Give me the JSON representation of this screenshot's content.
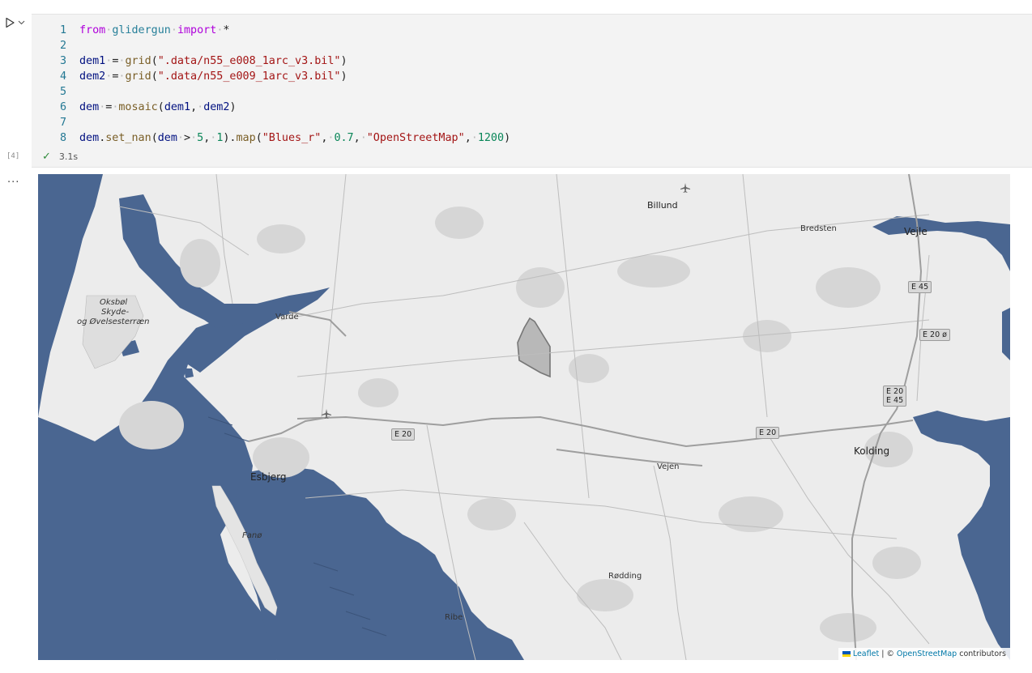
{
  "cell": {
    "execution_count": "[4]",
    "duration": "3.1s",
    "output_more": "..."
  },
  "code": {
    "lines": [
      {
        "n": "1",
        "text": "from glidergun import *"
      },
      {
        "n": "2",
        "text": ""
      },
      {
        "n": "3",
        "text": "dem1 = grid(\".data/n55_e008_1arc_v3.bil\")"
      },
      {
        "n": "4",
        "text": "dem2 = grid(\".data/n55_e009_1arc_v3.bil\")"
      },
      {
        "n": "5",
        "text": ""
      },
      {
        "n": "6",
        "text": "dem = mosaic(dem1, dem2)"
      },
      {
        "n": "7",
        "text": ""
      },
      {
        "n": "8",
        "text": "dem.set_nan(dem > 5, 1).map(\"Blues_r\", 0.7, \"OpenStreetMap\", 1200)"
      }
    ]
  },
  "map": {
    "water_color": "#4a6691",
    "land_color": "#ececec",
    "places": {
      "billund": "Billund",
      "bredsten": "Bredsten",
      "vejle": "Vejle",
      "oksbol_1": "Oksbøl",
      "oksbol_2": "Skyde-",
      "oksbol_3": "og Øvelsesterræn",
      "varde": "Varde",
      "esbjerg": "Esbjerg",
      "fano": "Fanø",
      "vejen": "Vejen",
      "kolding": "Kolding",
      "rodding": "Rødding",
      "ribe": "Ribe"
    },
    "shields": {
      "e20_west": "E 20",
      "e20_mid": "E 20",
      "e45": "E 45",
      "e20o": "E 20 ø",
      "e20_e45_a": "E 20",
      "e20_e45_b": "E 45"
    },
    "attribution": {
      "leaflet": "Leaflet",
      "sep": "| ©",
      "osm": "OpenStreetMap",
      "contributors": "contributors"
    }
  }
}
